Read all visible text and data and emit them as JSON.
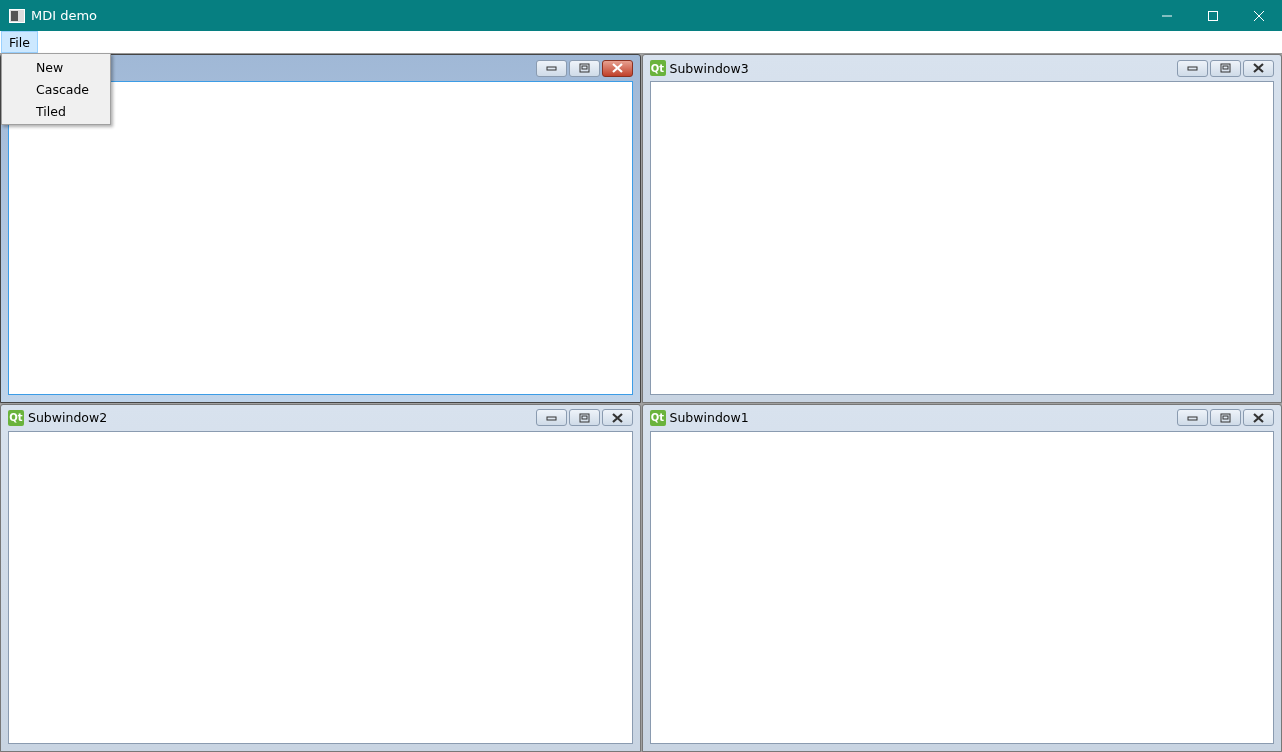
{
  "window": {
    "title": "MDI demo"
  },
  "menubar": [
    {
      "label": "File",
      "selected": true
    }
  ],
  "menu": {
    "items": [
      {
        "label": "New"
      },
      {
        "label": "Cascade"
      },
      {
        "label": "Tiled"
      }
    ]
  },
  "subwindows": [
    {
      "active": true
    },
    {
      "title": "Subwindow3",
      "logo": "Qt",
      "active": false
    },
    {
      "title": "Subwindow2",
      "logo": "Qt",
      "active": false
    },
    {
      "title": "Subwindow1",
      "logo": "Qt",
      "active": false
    }
  ]
}
